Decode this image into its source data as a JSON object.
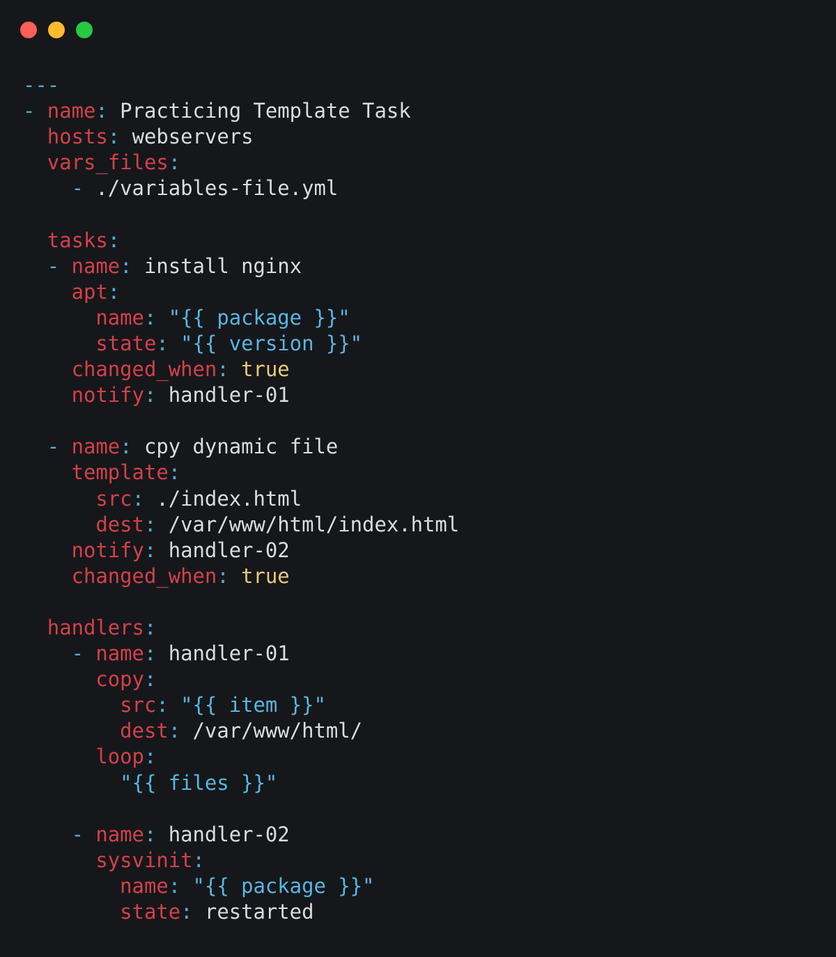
{
  "window": {
    "controls": [
      "close",
      "minimize",
      "zoom"
    ],
    "colors": {
      "close": "#fe5f57",
      "minimize": "#febc2e",
      "zoom": "#28c840",
      "background": "#16171b"
    }
  },
  "syntax_colors": {
    "key": "#d2414a",
    "punct": "#4fb0d6",
    "value": "#dcdcdc",
    "string": "#58b6e0",
    "boolean": "#e8cb77"
  },
  "code": {
    "lines": [
      [
        {
          "t": "---",
          "c": "p"
        }
      ],
      [
        {
          "t": "- ",
          "c": "p"
        },
        {
          "t": "name",
          "c": "k"
        },
        {
          "t": ": ",
          "c": "p"
        },
        {
          "t": "Practicing Template Task",
          "c": "v"
        }
      ],
      [
        {
          "t": "  ",
          "c": "v"
        },
        {
          "t": "hosts",
          "c": "k"
        },
        {
          "t": ": ",
          "c": "p"
        },
        {
          "t": "webservers",
          "c": "v"
        }
      ],
      [
        {
          "t": "  ",
          "c": "v"
        },
        {
          "t": "vars_files",
          "c": "k"
        },
        {
          "t": ":",
          "c": "p"
        }
      ],
      [
        {
          "t": "    ",
          "c": "v"
        },
        {
          "t": "- ",
          "c": "p"
        },
        {
          "t": "./variables-file.yml",
          "c": "v"
        }
      ],
      [],
      [
        {
          "t": "  ",
          "c": "v"
        },
        {
          "t": "tasks",
          "c": "k"
        },
        {
          "t": ":",
          "c": "p"
        }
      ],
      [
        {
          "t": "  ",
          "c": "v"
        },
        {
          "t": "- ",
          "c": "p"
        },
        {
          "t": "name",
          "c": "k"
        },
        {
          "t": ": ",
          "c": "p"
        },
        {
          "t": "install nginx",
          "c": "v"
        }
      ],
      [
        {
          "t": "    ",
          "c": "v"
        },
        {
          "t": "apt",
          "c": "k"
        },
        {
          "t": ":",
          "c": "p"
        }
      ],
      [
        {
          "t": "      ",
          "c": "v"
        },
        {
          "t": "name",
          "c": "k"
        },
        {
          "t": ": ",
          "c": "p"
        },
        {
          "t": "\"{{ package }}\"",
          "c": "s"
        }
      ],
      [
        {
          "t": "      ",
          "c": "v"
        },
        {
          "t": "state",
          "c": "k"
        },
        {
          "t": ": ",
          "c": "p"
        },
        {
          "t": "\"{{ version }}\"",
          "c": "s"
        }
      ],
      [
        {
          "t": "    ",
          "c": "v"
        },
        {
          "t": "changed_when",
          "c": "k"
        },
        {
          "t": ": ",
          "c": "p"
        },
        {
          "t": "true",
          "c": "b"
        }
      ],
      [
        {
          "t": "    ",
          "c": "v"
        },
        {
          "t": "notify",
          "c": "k"
        },
        {
          "t": ": ",
          "c": "p"
        },
        {
          "t": "handler-01",
          "c": "v"
        }
      ],
      [],
      [
        {
          "t": "  ",
          "c": "v"
        },
        {
          "t": "- ",
          "c": "p"
        },
        {
          "t": "name",
          "c": "k"
        },
        {
          "t": ": ",
          "c": "p"
        },
        {
          "t": "cpy dynamic file",
          "c": "v"
        }
      ],
      [
        {
          "t": "    ",
          "c": "v"
        },
        {
          "t": "template",
          "c": "k"
        },
        {
          "t": ":",
          "c": "p"
        }
      ],
      [
        {
          "t": "      ",
          "c": "v"
        },
        {
          "t": "src",
          "c": "k"
        },
        {
          "t": ": ",
          "c": "p"
        },
        {
          "t": "./index.html",
          "c": "v"
        }
      ],
      [
        {
          "t": "      ",
          "c": "v"
        },
        {
          "t": "dest",
          "c": "k"
        },
        {
          "t": ": ",
          "c": "p"
        },
        {
          "t": "/var/www/html/index.html",
          "c": "v"
        }
      ],
      [
        {
          "t": "    ",
          "c": "v"
        },
        {
          "t": "notify",
          "c": "k"
        },
        {
          "t": ": ",
          "c": "p"
        },
        {
          "t": "handler-02",
          "c": "v"
        }
      ],
      [
        {
          "t": "    ",
          "c": "v"
        },
        {
          "t": "changed_when",
          "c": "k"
        },
        {
          "t": ": ",
          "c": "p"
        },
        {
          "t": "true",
          "c": "b"
        }
      ],
      [],
      [
        {
          "t": "  ",
          "c": "v"
        },
        {
          "t": "handlers",
          "c": "k"
        },
        {
          "t": ":",
          "c": "p"
        }
      ],
      [
        {
          "t": "    ",
          "c": "v"
        },
        {
          "t": "- ",
          "c": "p"
        },
        {
          "t": "name",
          "c": "k"
        },
        {
          "t": ": ",
          "c": "p"
        },
        {
          "t": "handler-01",
          "c": "v"
        }
      ],
      [
        {
          "t": "      ",
          "c": "v"
        },
        {
          "t": "copy",
          "c": "k"
        },
        {
          "t": ":",
          "c": "p"
        }
      ],
      [
        {
          "t": "        ",
          "c": "v"
        },
        {
          "t": "src",
          "c": "k"
        },
        {
          "t": ": ",
          "c": "p"
        },
        {
          "t": "\"{{ item }}\"",
          "c": "s"
        }
      ],
      [
        {
          "t": "        ",
          "c": "v"
        },
        {
          "t": "dest",
          "c": "k"
        },
        {
          "t": ": ",
          "c": "p"
        },
        {
          "t": "/var/www/html/",
          "c": "v"
        }
      ],
      [
        {
          "t": "      ",
          "c": "v"
        },
        {
          "t": "loop",
          "c": "k"
        },
        {
          "t": ":",
          "c": "p"
        }
      ],
      [
        {
          "t": "        ",
          "c": "v"
        },
        {
          "t": "\"{{ files }}\"",
          "c": "s"
        }
      ],
      [],
      [
        {
          "t": "    ",
          "c": "v"
        },
        {
          "t": "- ",
          "c": "p"
        },
        {
          "t": "name",
          "c": "k"
        },
        {
          "t": ": ",
          "c": "p"
        },
        {
          "t": "handler-02",
          "c": "v"
        }
      ],
      [
        {
          "t": "      ",
          "c": "v"
        },
        {
          "t": "sysvinit",
          "c": "k"
        },
        {
          "t": ":",
          "c": "p"
        }
      ],
      [
        {
          "t": "        ",
          "c": "v"
        },
        {
          "t": "name",
          "c": "k"
        },
        {
          "t": ": ",
          "c": "p"
        },
        {
          "t": "\"{{ package }}\"",
          "c": "s"
        }
      ],
      [
        {
          "t": "        ",
          "c": "v"
        },
        {
          "t": "state",
          "c": "k"
        },
        {
          "t": ": ",
          "c": "p"
        },
        {
          "t": "restarted",
          "c": "v"
        }
      ]
    ]
  }
}
